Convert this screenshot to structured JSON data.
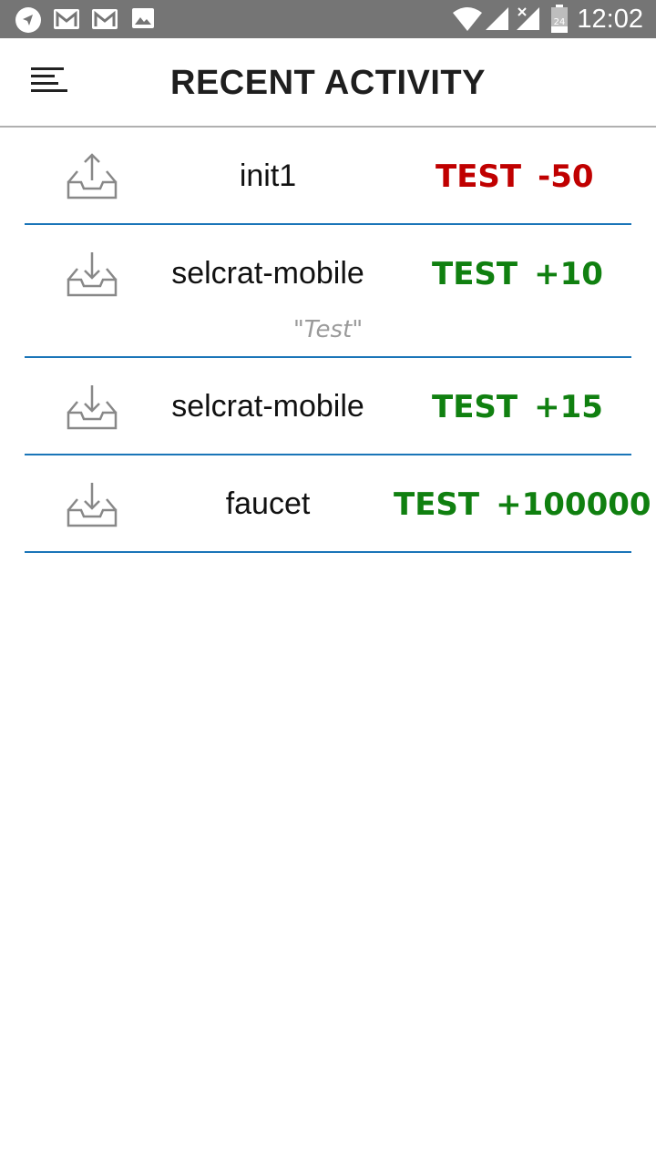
{
  "status_bar": {
    "time": "12:02",
    "icons": [
      "navigation-icon",
      "gmail-icon",
      "gmail-icon",
      "image-icon",
      "wifi-icon",
      "signal-icon",
      "signal-no-data-icon",
      "battery-icon"
    ],
    "battery_level": "24"
  },
  "header": {
    "title": "RECENT ACTIVITY",
    "menu_icon": "menu-icon"
  },
  "colors": {
    "outgoing": "#c00000",
    "incoming": "#108010",
    "divider": "#1a75b8"
  },
  "transactions": [
    {
      "direction": "outgoing",
      "icon": "upload-tray-icon",
      "name": "init1",
      "currency": "TEST",
      "amount": "-50",
      "memo": ""
    },
    {
      "direction": "incoming",
      "icon": "download-tray-icon",
      "name": "selcrat-mobile",
      "currency": "TEST",
      "amount": "+10",
      "memo": "\"Test\""
    },
    {
      "direction": "incoming",
      "icon": "download-tray-icon",
      "name": "selcrat-mobile",
      "currency": "TEST",
      "amount": "+15",
      "memo": ""
    },
    {
      "direction": "incoming",
      "icon": "download-tray-icon",
      "name": "faucet",
      "currency": "TEST",
      "amount": "+100000",
      "memo": ""
    }
  ]
}
